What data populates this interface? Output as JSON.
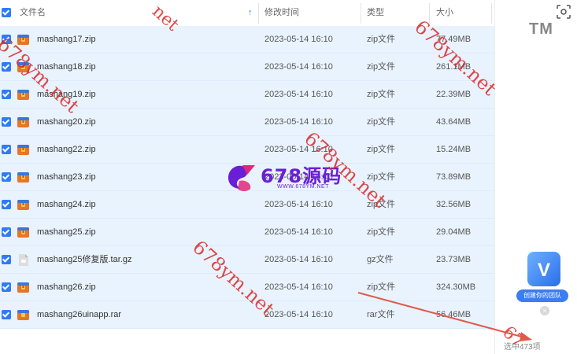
{
  "header": {
    "name_label": "文件名",
    "sort_indicator": "↑",
    "mtime_label": "修改时间",
    "type_label": "类型",
    "size_label": "大小"
  },
  "files": [
    {
      "name": "mashang17.zip",
      "mtime": "2023-05-14 16:10",
      "type": "zip文件",
      "size": "77.49MB",
      "icon": "zip-archive-icon"
    },
    {
      "name": "mashang18.zip",
      "mtime": "2023-05-14 16:10",
      "type": "zip文件",
      "size": "261.1MB",
      "icon": "zip-archive-icon"
    },
    {
      "name": "mashang19.zip",
      "mtime": "2023-05-14 16:10",
      "type": "zip文件",
      "size": "22.39MB",
      "icon": "zip-archive-icon"
    },
    {
      "name": "mashang20.zip",
      "mtime": "2023-05-14 16:10",
      "type": "zip文件",
      "size": "43.64MB",
      "icon": "zip-archive-icon"
    },
    {
      "name": "mashang22.zip",
      "mtime": "2023-05-14 16:10",
      "type": "zip文件",
      "size": "15.24MB",
      "icon": "zip-archive-icon"
    },
    {
      "name": "mashang23.zip",
      "mtime": "2023-05-14 16:10",
      "type": "zip文件",
      "size": "73.89MB",
      "icon": "zip-archive-icon"
    },
    {
      "name": "mashang24.zip",
      "mtime": "2023-05-14 16:10",
      "type": "zip文件",
      "size": "32.56MB",
      "icon": "zip-archive-icon"
    },
    {
      "name": "mashang25.zip",
      "mtime": "2023-05-14 16:10",
      "type": "zip文件",
      "size": "29.04MB",
      "icon": "zip-archive-icon"
    },
    {
      "name": "mashang25修复版.tar.gz",
      "mtime": "2023-05-14 16:10",
      "type": "gz文件",
      "size": "23.73MB",
      "icon": "gz-file-icon"
    },
    {
      "name": "mashang26.zip",
      "mtime": "2023-05-14 16:10",
      "type": "zip文件",
      "size": "324.30MB",
      "icon": "zip-archive-icon"
    },
    {
      "name": "mashang26uinapp.rar",
      "mtime": "2023-05-14 16:10",
      "type": "rar文件",
      "size": "56.46MB",
      "icon": "rar-archive-icon"
    }
  ],
  "right_panel": {
    "tm_mark": "TM",
    "team_label": "创建你的团队",
    "close_symbol": "×"
  },
  "status": {
    "text": "选中473项"
  },
  "logo": {
    "brand": "678源码",
    "url": "WWW.678YM.NET"
  },
  "watermark": {
    "text": "678ym.net",
    "text_partial": "net",
    "text_partial2": "67"
  },
  "colors": {
    "accent": "#2e7cf6",
    "row_selected": "#e9f3fe",
    "watermark": "#d92a2a",
    "logo": "#6a1fd6"
  }
}
